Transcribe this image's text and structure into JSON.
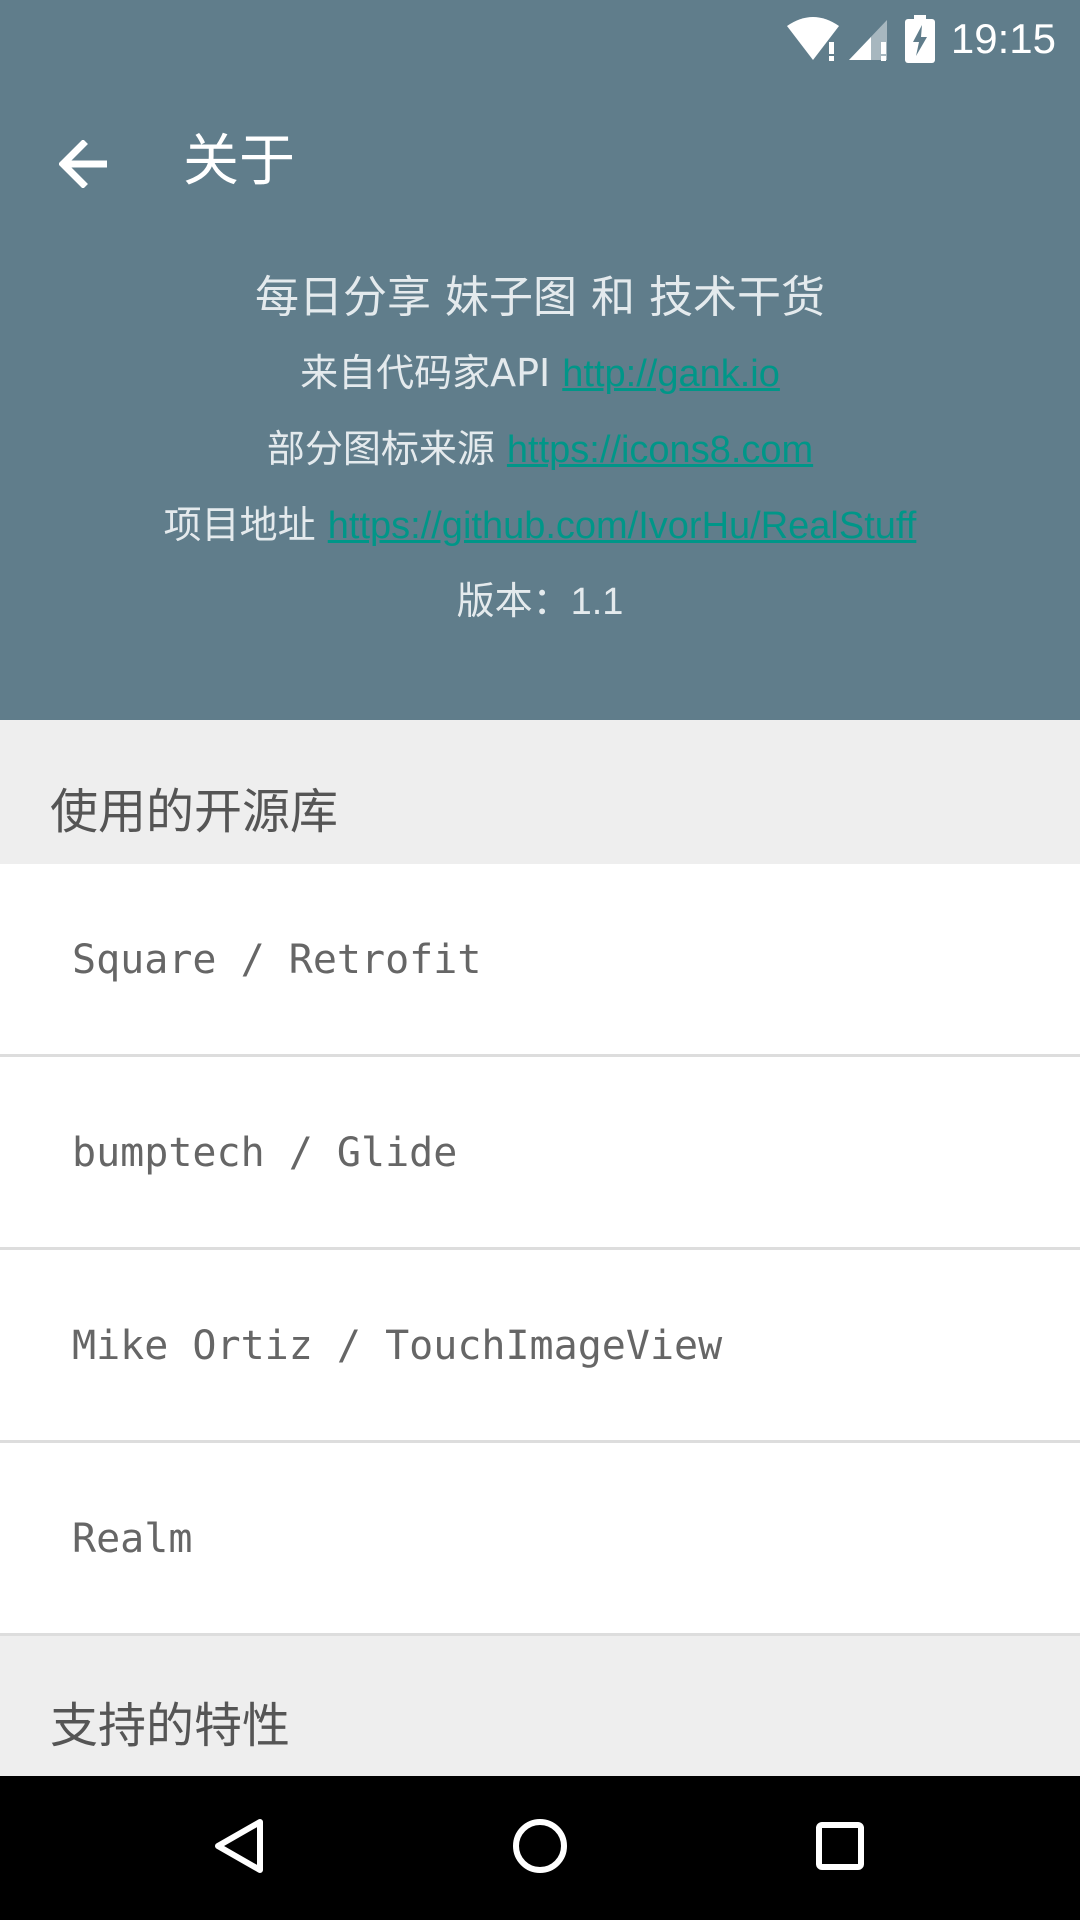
{
  "status_bar": {
    "time": "19:15",
    "icons": [
      "wifi-icon",
      "signal-icon",
      "battery-charging-icon"
    ]
  },
  "toolbar": {
    "back_icon": "arrow-left-icon",
    "title": "关于"
  },
  "about": {
    "slogan": "每日分享 妹子图 和 技术干货",
    "api_prefix": "来自代码家API ",
    "api_link": "http://gank.io",
    "icons_prefix": "部分图标来源 ",
    "icons_link": "https://icons8.com",
    "project_prefix": "项目地址 ",
    "project_link": "https://github.com/IvorHu/RealStuff",
    "version_label": "版本：",
    "version_value": "1.1"
  },
  "libraries_section": {
    "title": "使用的开源库",
    "items": [
      "Square / Retrofit",
      "bumptech / Glide",
      "Mike Ortiz / TouchImageView",
      "Realm"
    ]
  },
  "features_section": {
    "title": "支持的特性"
  },
  "nav_bar": {
    "icons": [
      "back-triangle-icon",
      "home-circle-icon",
      "recents-square-icon"
    ]
  },
  "colors": {
    "primary": "#607d8b",
    "link": "#009688",
    "nav_background": "#000000"
  }
}
